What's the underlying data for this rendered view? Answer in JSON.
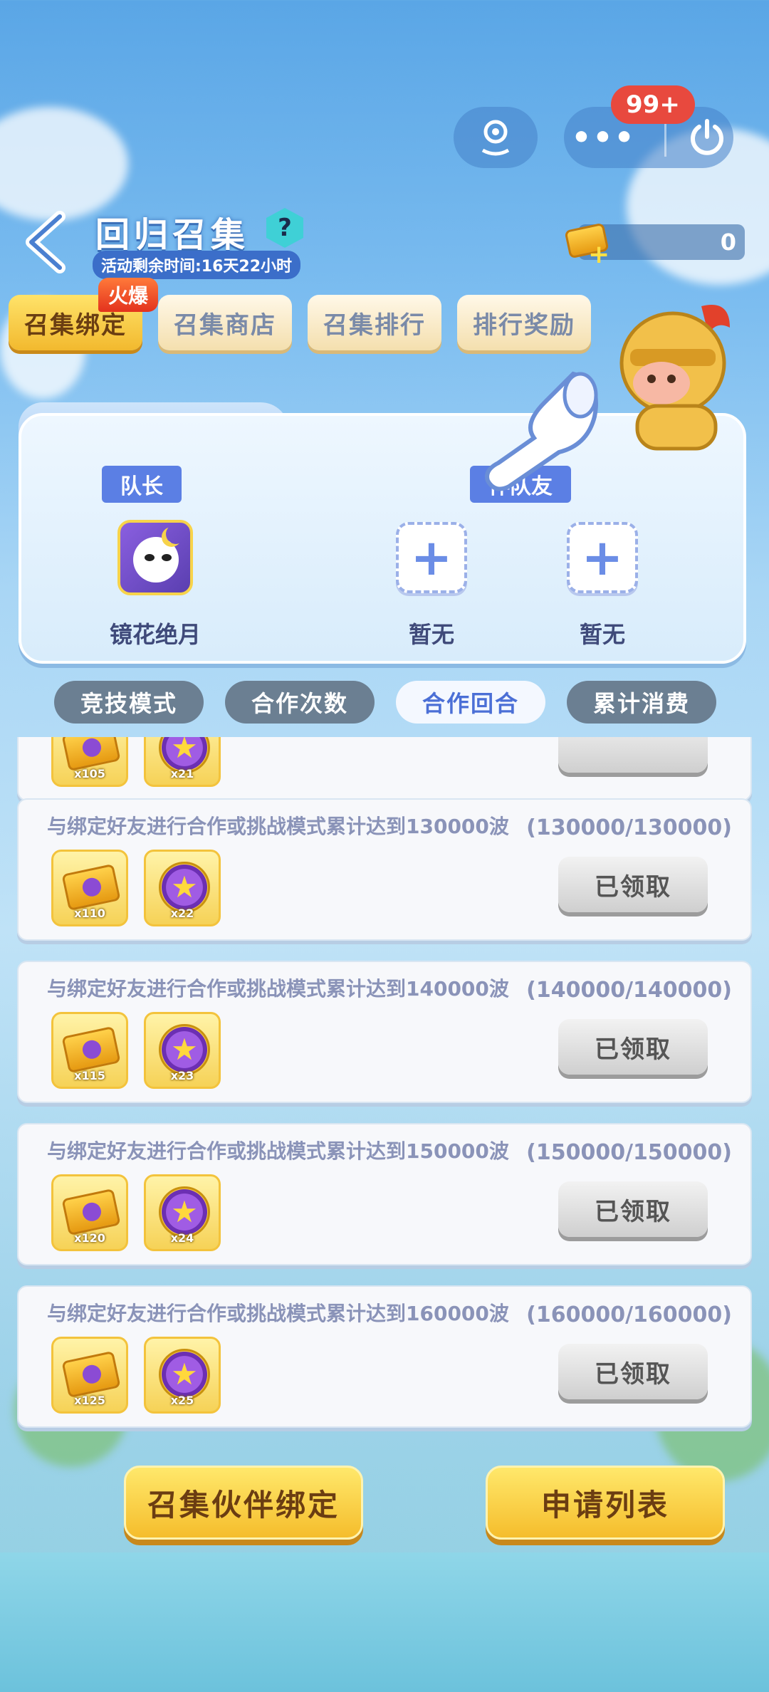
{
  "notification_badge": "99+",
  "header": {
    "title": "回归召集",
    "timer_text": "活动剩余时间:16天22小时",
    "help_label": "?",
    "coin_count": "0"
  },
  "main_tabs": [
    {
      "label": "召集绑定",
      "active": true,
      "badge": "火爆"
    },
    {
      "label": "召集商店",
      "active": false
    },
    {
      "label": "召集排行",
      "active": false
    },
    {
      "label": "排行奖励",
      "active": false
    }
  ],
  "team": {
    "captain_label": "队长",
    "partner_label": "伴队友",
    "captain_name": "镜花绝月",
    "slot1_name": "暂无",
    "slot2_name": "暂无"
  },
  "sub_tabs": [
    {
      "label": "竞技模式",
      "active": false
    },
    {
      "label": "合作次数",
      "active": false
    },
    {
      "label": "合作回合",
      "active": true
    },
    {
      "label": "累计消费",
      "active": false
    }
  ],
  "partial_card": {
    "reward1_count": "x105",
    "reward2_count": "x21"
  },
  "tasks": [
    {
      "desc": "与绑定好友进行合作或挑战模式累计达到130000波",
      "progress": "(130000/130000)",
      "reward1_count": "x110",
      "reward2_count": "x22",
      "button": "已领取"
    },
    {
      "desc": "与绑定好友进行合作或挑战模式累计达到140000波",
      "progress": "(140000/140000)",
      "reward1_count": "x115",
      "reward2_count": "x23",
      "button": "已领取"
    },
    {
      "desc": "与绑定好友进行合作或挑战模式累计达到150000波",
      "progress": "(150000/150000)",
      "reward1_count": "x120",
      "reward2_count": "x24",
      "button": "已领取"
    },
    {
      "desc": "与绑定好友进行合作或挑战模式累计达到160000波",
      "progress": "(160000/160000)",
      "reward1_count": "x125",
      "reward2_count": "x25",
      "button": "已领取"
    }
  ],
  "bottom_buttons": {
    "bind_label": "召集伙伴绑定",
    "apply_label": "申请列表"
  },
  "icons": {
    "back": "chevron-left-icon",
    "location": "location-pin-icon",
    "more": "more-dots-icon",
    "power": "power-icon",
    "ticket": "ticket-icon",
    "star_coin": "star-coin-icon",
    "plus": "plus-icon"
  }
}
